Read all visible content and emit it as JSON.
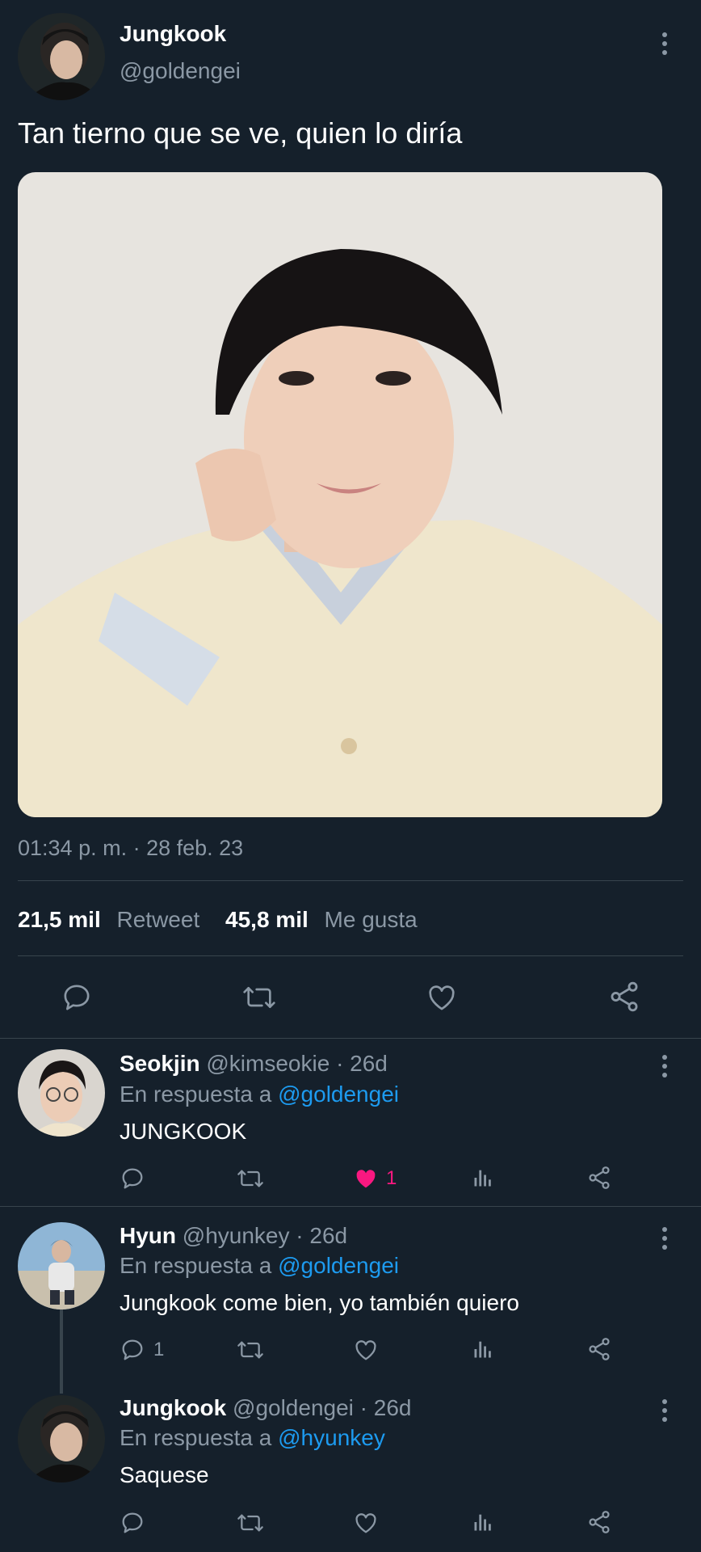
{
  "tweet": {
    "author_name": "Jungkook",
    "author_handle": "@goldengei",
    "text": "Tan tierno que se ve, quien lo diría",
    "timestamp": "01:34 p. m. · 28 feb. 23",
    "retweets_count": "21,5 mil",
    "retweets_label": "Retweet",
    "likes_count": "45,8 mil",
    "likes_label": "Me gusta"
  },
  "replies": [
    {
      "name": "Seokjin",
      "handle": "@kimseokie",
      "age": "· 26d",
      "reply_prefix": "En respuesta a",
      "reply_to": "@goldengei",
      "text": "JUNGKOOK",
      "reply_count": "",
      "like_count": "1",
      "liked": true
    },
    {
      "name": "Hyun",
      "handle": "@hyunkey",
      "age": "· 26d",
      "reply_prefix": "En respuesta a",
      "reply_to": "@goldengei",
      "text": "Jungkook come bien, yo también quiero",
      "reply_count": "1",
      "like_count": "",
      "liked": false
    },
    {
      "name": "Jungkook",
      "handle": "@goldengei",
      "age": "· 26d",
      "reply_prefix": "En respuesta a",
      "reply_to": "@hyunkey",
      "text": "Saquese",
      "reply_count": "",
      "like_count": "",
      "liked": false
    }
  ],
  "colors": {
    "background": "#15202b",
    "muted": "#8b98a5",
    "link": "#1d9bf0",
    "like_active": "#f91880"
  }
}
